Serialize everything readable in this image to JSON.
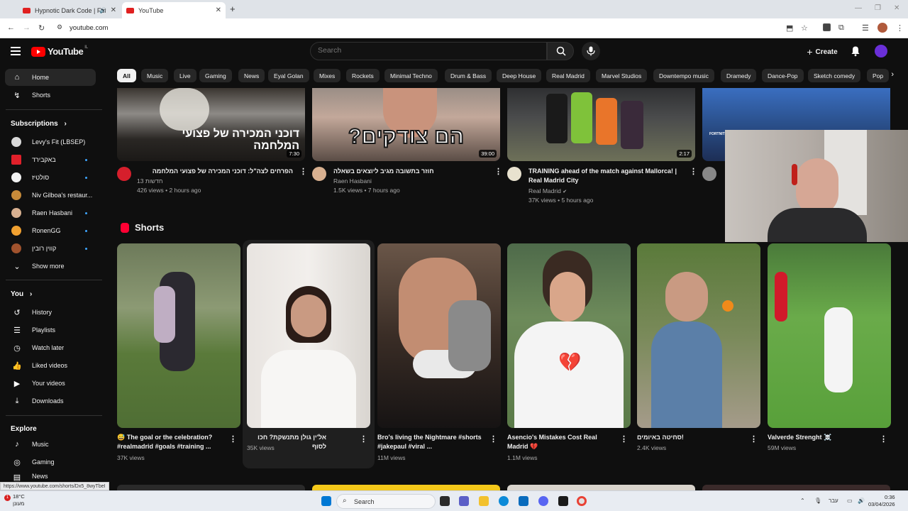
{
  "browser": {
    "tabs": [
      {
        "title": "Hypnotic Dark Code | Futu"
      },
      {
        "title": "YouTube"
      }
    ],
    "url": "youtube.com",
    "status_url": "https://www.youtube.com/shorts/Dx5_8wyTbeI"
  },
  "header": {
    "logo_text": "YouTube",
    "country_code": "IL",
    "search_placeholder": "Search",
    "create_label": "Create"
  },
  "sidebar": {
    "main": [
      {
        "label": "Home",
        "icon": "home-icon"
      },
      {
        "label": "Shorts",
        "icon": "shorts-icon"
      }
    ],
    "subscriptions_title": "Subscriptions",
    "subscriptions": [
      {
        "label": "Levy's Fit (LBSEP)",
        "color": "#d9d9d9"
      },
      {
        "label": "באקבירד",
        "color": "#e0202a"
      },
      {
        "label": "סולטיז",
        "color": "#f2f2f2"
      },
      {
        "label": "Niv Gilboa's restaur...",
        "color": "#c68a3a"
      },
      {
        "label": "Raen Hasbani",
        "color": "#d8b090"
      },
      {
        "label": "RonenGG",
        "color": "#f0a030"
      },
      {
        "label": "קווין רובין",
        "color": "#a0522d"
      }
    ],
    "show_more": "Show more",
    "you_title": "You",
    "you": [
      {
        "label": "History",
        "icon": "history-icon"
      },
      {
        "label": "Playlists",
        "icon": "playlists-icon"
      },
      {
        "label": "Watch later",
        "icon": "watch-later-icon"
      },
      {
        "label": "Liked videos",
        "icon": "liked-videos-icon"
      },
      {
        "label": "Your videos",
        "icon": "your-videos-icon"
      },
      {
        "label": "Downloads",
        "icon": "downloads-icon"
      }
    ],
    "explore_title": "Explore",
    "explore": [
      {
        "label": "Music",
        "icon": "music-icon"
      },
      {
        "label": "Gaming",
        "icon": "gaming-icon"
      },
      {
        "label": "News",
        "icon": "news-icon"
      }
    ]
  },
  "chips": [
    "All",
    "Music",
    "Live",
    "Gaming",
    "News",
    "Eyal Golan",
    "Mixes",
    "Rockets",
    "Minimal Techno",
    "Drum & Bass",
    "Deep House",
    "Real Madrid",
    "Marvel Studios",
    "Downtempo music",
    "Dramedy",
    "Dance-Pop",
    "Sketch comedy",
    "Pop"
  ],
  "videos": [
    {
      "thumb_text": "דוכני המכירה של פצועי המלחמה",
      "duration": "7:30",
      "title": "הפרחים לצה\"ל: דוכני המכירה של פצועי המלחמה",
      "channel": "חדשות 13",
      "meta": "426 views • 2 hours ago",
      "avatar_color": "#d61f2c"
    },
    {
      "thumb_text": "הם צודקים?",
      "duration": "39:00",
      "title": "חוזר בתשובה מגיב ליוצאים בשאלה",
      "channel": "Raen Hasbani",
      "meta": "1.5K views • 7 hours ago",
      "avatar_color": "#d8b090"
    },
    {
      "thumb_text": "",
      "duration": "2:17",
      "title": "TRAINING ahead of the match against Mallorca! | Real Madrid City",
      "channel": "Real Madrid",
      "meta": "37K views • 5 hours ago",
      "avatar_color": "#e8e2cf"
    },
    {
      "thumb_text": "",
      "duration": "",
      "title": "",
      "channel": "",
      "meta": "",
      "avatar_color": "#888888"
    }
  ],
  "shorts_title": "Shorts",
  "shorts": [
    {
      "title": "😅 The goal or the celebration? #realmadrid #goals #training ...",
      "views": "37K views"
    },
    {
      "title": "אל'ין גולן מתנשקת? חכו לסוף",
      "views": "35K views"
    },
    {
      "title": "Bro's living the Nightmare #shorts #jakepaul #viral ...",
      "views": "11M views"
    },
    {
      "title": "Asencio's Mistakes Cost Real Madrid 💔",
      "views": "1.1M views"
    },
    {
      "title": "!סחיטה באיומים",
      "views": "2.4K views"
    },
    {
      "title": "Valverde Strenght ☠️",
      "views": "59M views"
    }
  ],
  "taskbar": {
    "weather_temp": "18°C",
    "weather_desc": "מעונן",
    "search_label": "Search",
    "language": "עבר",
    "time": "0:36",
    "date": "03/04/2026",
    "notification_count": "1"
  }
}
